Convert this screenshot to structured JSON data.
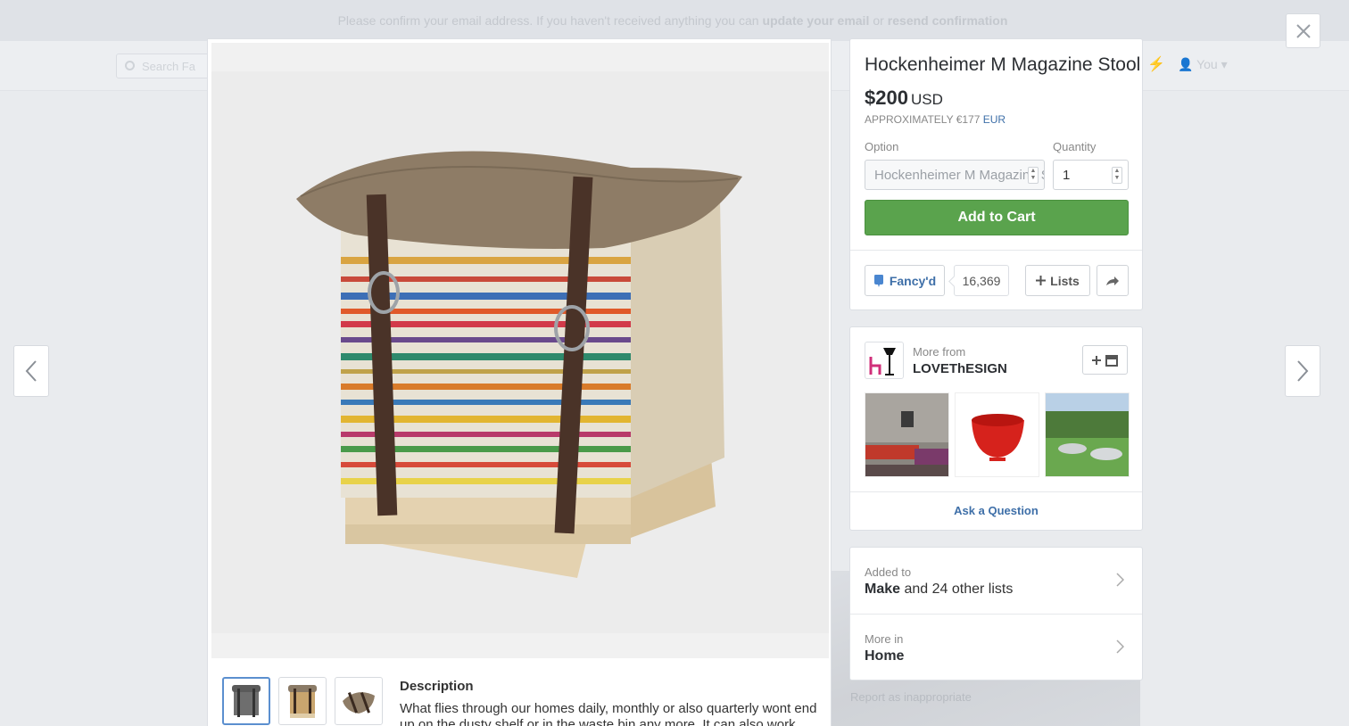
{
  "background": {
    "banner": {
      "text": "Please confirm your email address. If you haven't received anything you can",
      "link1": "update your email",
      "or": "or",
      "link2": "resend confirmation"
    },
    "search_placeholder": "Search Fa",
    "user_label": "You"
  },
  "product": {
    "title": "Hockenheimer M Magazine Stool",
    "price": "$200",
    "currency": "USD",
    "approx_prefix": "APPROXIMATELY €177",
    "approx_currency": "EUR",
    "option_label": "Option",
    "option_value": "Hockenheimer M Magazine Stool",
    "quantity_label": "Quantity",
    "quantity_value": "1",
    "add_to_cart": "Add to Cart",
    "fancyd_label": "Fancy'd",
    "fancy_count": "16,369",
    "lists_label": "Lists",
    "description_title": "Description",
    "description_text": "What flies through our homes daily, monthly or also quarterly wont end up on the dusty shelf or in the waste bin any more. It can also work differently"
  },
  "store": {
    "more_from": "More from",
    "name": "LOVEThESIGN",
    "ask_question": "Ask a Question"
  },
  "lists": {
    "added_to_label": "Added to",
    "added_to_bold": "Make",
    "added_to_rest": "and 24 other lists",
    "more_in_label": "More in",
    "more_in_value": "Home"
  },
  "footer": {
    "report": "Report as inappropriate"
  },
  "colors": {
    "accent_green": "#5aa34d",
    "link_blue": "#3e6fa8",
    "thumb_active": "#5b8fcf"
  },
  "icons": [
    "close-icon",
    "chevron-left-icon",
    "chevron-right-icon",
    "fancy-icon",
    "plus-icon",
    "share-icon",
    "store-icon",
    "chevron-right-icon"
  ]
}
